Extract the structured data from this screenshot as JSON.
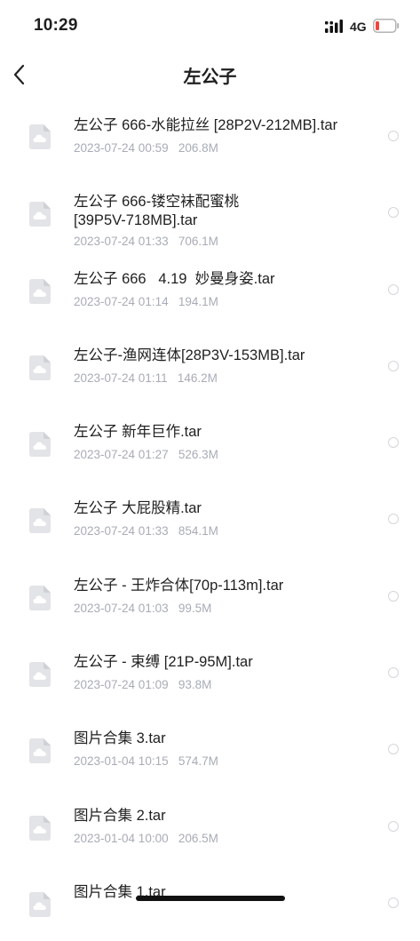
{
  "status_bar": {
    "time": "10:29",
    "network": "4G",
    "battery_color": "#f0453a"
  },
  "header": {
    "back_icon": "chevron-left-icon",
    "title": "左公子"
  },
  "files": [
    {
      "name": "左公子 666-水能拉丝 [28P2V-212MB].tar",
      "meta": "2023-07-24 00:59   206.8M"
    },
    {
      "name": "左公子 666-镂空袜配蜜桃\n[39P5V-718MB].tar",
      "meta": "2023-07-24 01:33   706.1M"
    },
    {
      "name": "左公子 666   4.19  妙曼身姿.tar",
      "meta": "2023-07-24 01:14   194.1M"
    },
    {
      "name": "左公子-渔网连体[28P3V-153MB].tar",
      "meta": "2023-07-24 01:11   146.2M"
    },
    {
      "name": "左公子 新年巨作.tar",
      "meta": "2023-07-24 01:27   526.3M"
    },
    {
      "name": "左公子 大屁股精.tar",
      "meta": "2023-07-24 01:33   854.1M"
    },
    {
      "name": "左公子 - 王炸合体[70p-113m].tar",
      "meta": "2023-07-24 01:03   99.5M"
    },
    {
      "name": "左公子 - 束缚 [21P-95M].tar",
      "meta": "2023-07-24 01:09   93.8M"
    },
    {
      "name": "图片合集 3.tar",
      "meta": "2023-01-04 10:15   574.7M"
    },
    {
      "name": "图片合集 2.tar",
      "meta": "2023-01-04 10:00   206.5M"
    },
    {
      "name": "图片合集 1.tar",
      "meta": ""
    }
  ]
}
